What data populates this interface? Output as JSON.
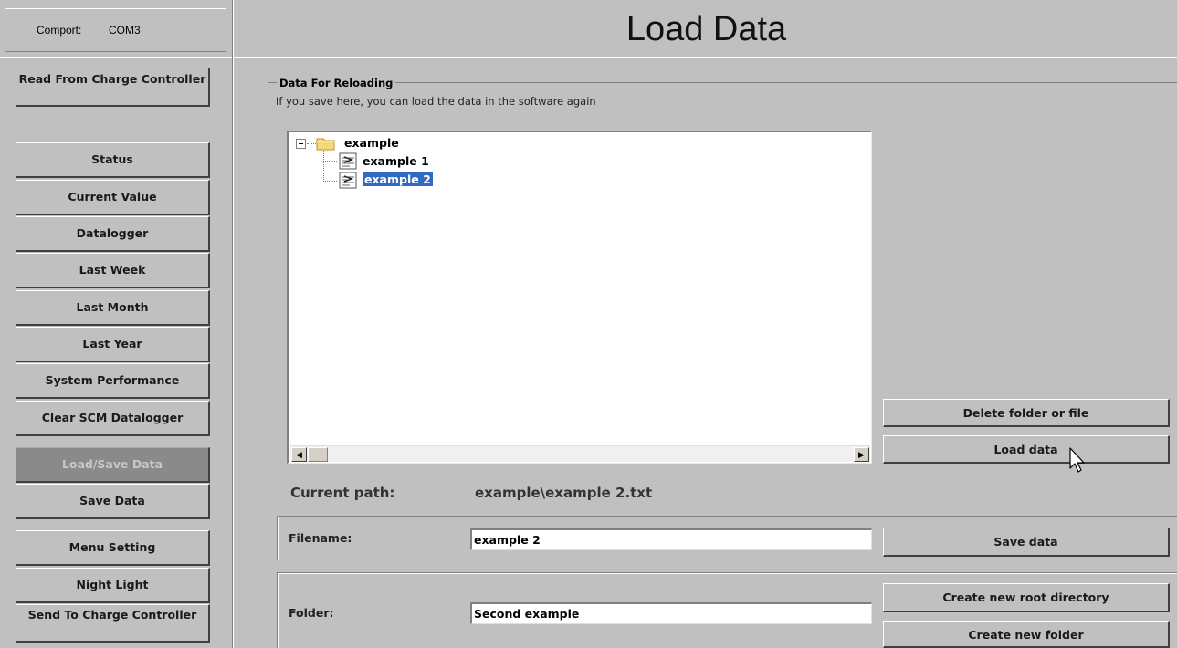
{
  "comport": {
    "label": "Comport:",
    "value": "COM3"
  },
  "sidebar": {
    "read_button": "Read From Charge Controller",
    "items": [
      {
        "label": "Status"
      },
      {
        "label": "Current Value"
      },
      {
        "label": "Datalogger"
      },
      {
        "label": "Last Week"
      },
      {
        "label": "Last Month"
      },
      {
        "label": "Last Year"
      },
      {
        "label": "System Performance"
      },
      {
        "label": "Clear SCM Datalogger"
      }
    ],
    "load_save": "Load/Save Data",
    "save_data": "Save Data",
    "menu_setting": "Menu Setting",
    "night_light": "Night Light",
    "send_button": "Send To Charge Controller"
  },
  "header": {
    "title": "Load Data"
  },
  "group": {
    "title": "Data For Reloading",
    "description": "If you save here, you can load the data in the software again"
  },
  "tree": {
    "root": "example",
    "children": [
      {
        "label": "example 1",
        "selected": false
      },
      {
        "label": "example 2",
        "selected": true
      }
    ]
  },
  "buttons": {
    "delete": "Delete folder or file",
    "load": "Load data",
    "save": "Save data",
    "create_root": "Create new root directory",
    "create_folder": "Create new folder"
  },
  "current_path": {
    "label": "Current path:",
    "value": "example\\example 2.txt"
  },
  "filename": {
    "label": "Filename:",
    "value": "example 2"
  },
  "folder": {
    "label": "Folder:",
    "value": "Second example"
  },
  "colors": {
    "background": "#c0c0c0",
    "selection": "#316ac5",
    "disabled_button": "#8a8a8a"
  }
}
